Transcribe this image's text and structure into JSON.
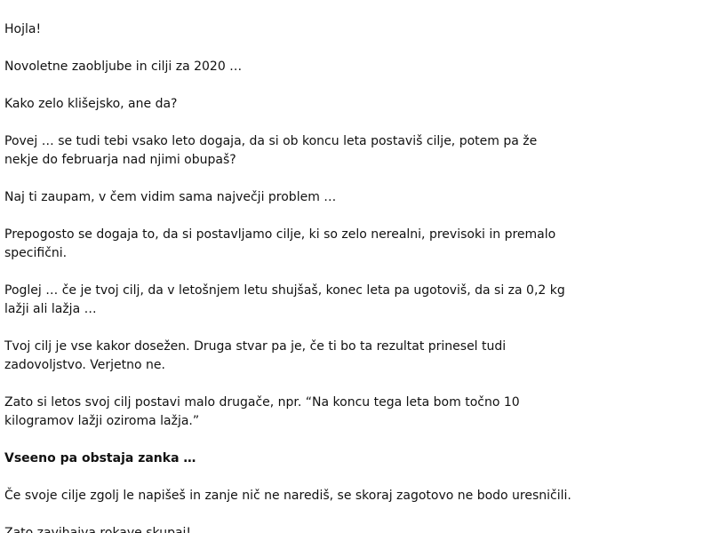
{
  "document": {
    "paragraphs": [
      "Hojla!",
      "Novoletne zaobljube in cilji za 2020 …",
      "Kako zelo klišejsko, ane da?",
      "Povej … se tudi tebi vsako leto dogaja, da si ob koncu leta postaviš cilje, potem pa že nekje do februarja nad njimi obupaš?",
      "Naj ti zaupam, v čem vidim sama največji problem …",
      "Prepogosto se dogaja to, da si postavljamo cilje, ki so zelo nerealni, previsoki in premalo specifični.",
      "Poglej … če je tvoj cilj, da v letošnjem letu shujšaš, konec leta pa ugotoviš, da si za 0,2 kg lažji ali lažja …",
      "Tvoj cilj je vse kakor dosežen. Druga stvar pa je, če ti bo ta rezultat prinesel tudi zadovoljstvo. Verjetno ne.",
      "Zato si letos svoj cilj postavi malo drugače, npr. “Na koncu tega leta bom točno 10 kilogramov lažji oziroma lažja.”",
      "Vseeno pa obstaja zanka …",
      "Če svoje cilje zgolj le napišeš in zanje nič ne narediš, se skoraj zagotovo ne bodo uresničili.",
      "Zato zavihajva rokave skupaj!"
    ]
  }
}
